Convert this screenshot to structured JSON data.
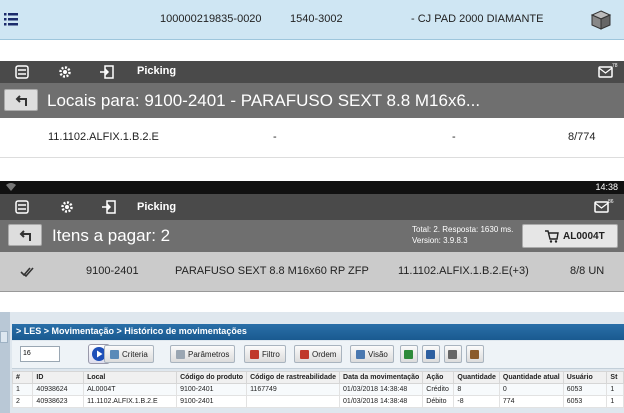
{
  "panel1": {
    "code": "100000219835-0020",
    "ref": "1540-3002",
    "description": "- CJ PAD 2000 DIAMANTE"
  },
  "toolbar1": {
    "title": "Picking",
    "mail_count": "78"
  },
  "panel2": {
    "header": "Locais para: 9100-2401 - PARAFUSO SEXT 8.8 M16x6...",
    "location": "11.1102.ALFIX.1.B.2.E",
    "col2": "-",
    "col3": "-",
    "count": "8/774"
  },
  "statusbar": {
    "time": "14:38"
  },
  "toolbar2": {
    "title": "Picking",
    "mail_count": "86"
  },
  "panel3": {
    "header": "Itens a pagar: 2",
    "total_line": "Total: 2. Resposta: 1630 ms.",
    "version_line": "Version: 3.9.8.3",
    "cart_label": "AL0004T"
  },
  "panel4": {
    "code": "9100-2401",
    "description": "PARAFUSO SEXT 8.8 M16x60 RP ZFP",
    "location": "11.1102.ALFIX.1.B.2.E(+3)",
    "qty": "8/8 UN"
  },
  "web": {
    "breadcrumb": "> LES > Movimentação > Histórico de movimentações",
    "page_size": "16",
    "buttons": [
      "Criteria",
      "Parâmetros",
      "Filtro",
      "Ordem",
      "Visão"
    ],
    "button_colors": [
      "#5a8ab8",
      "#9aa6b2",
      "#c0392b",
      "#c0392b",
      "#4a78b0"
    ],
    "columns": [
      "#",
      "ID",
      "Local",
      "Código do produto",
      "Código de rastreabilidade",
      "Data da movimentação",
      "Ação",
      "Quantidade",
      "Quantidade atual",
      "Usuário",
      "St"
    ],
    "rows": [
      [
        "1",
        "40938624",
        "AL0004T",
        "9100-2401",
        "1167749",
        "01/03/2018 14:38:48",
        "Crédito",
        "8",
        "0",
        "6053",
        "1"
      ],
      [
        "2",
        "40938623",
        "11.1102.ALFIX.1.B.2.E",
        "9100-2401",
        "",
        "01/03/2018 14:38:48",
        "Débito",
        "-8",
        "774",
        "6053",
        "1"
      ]
    ]
  }
}
